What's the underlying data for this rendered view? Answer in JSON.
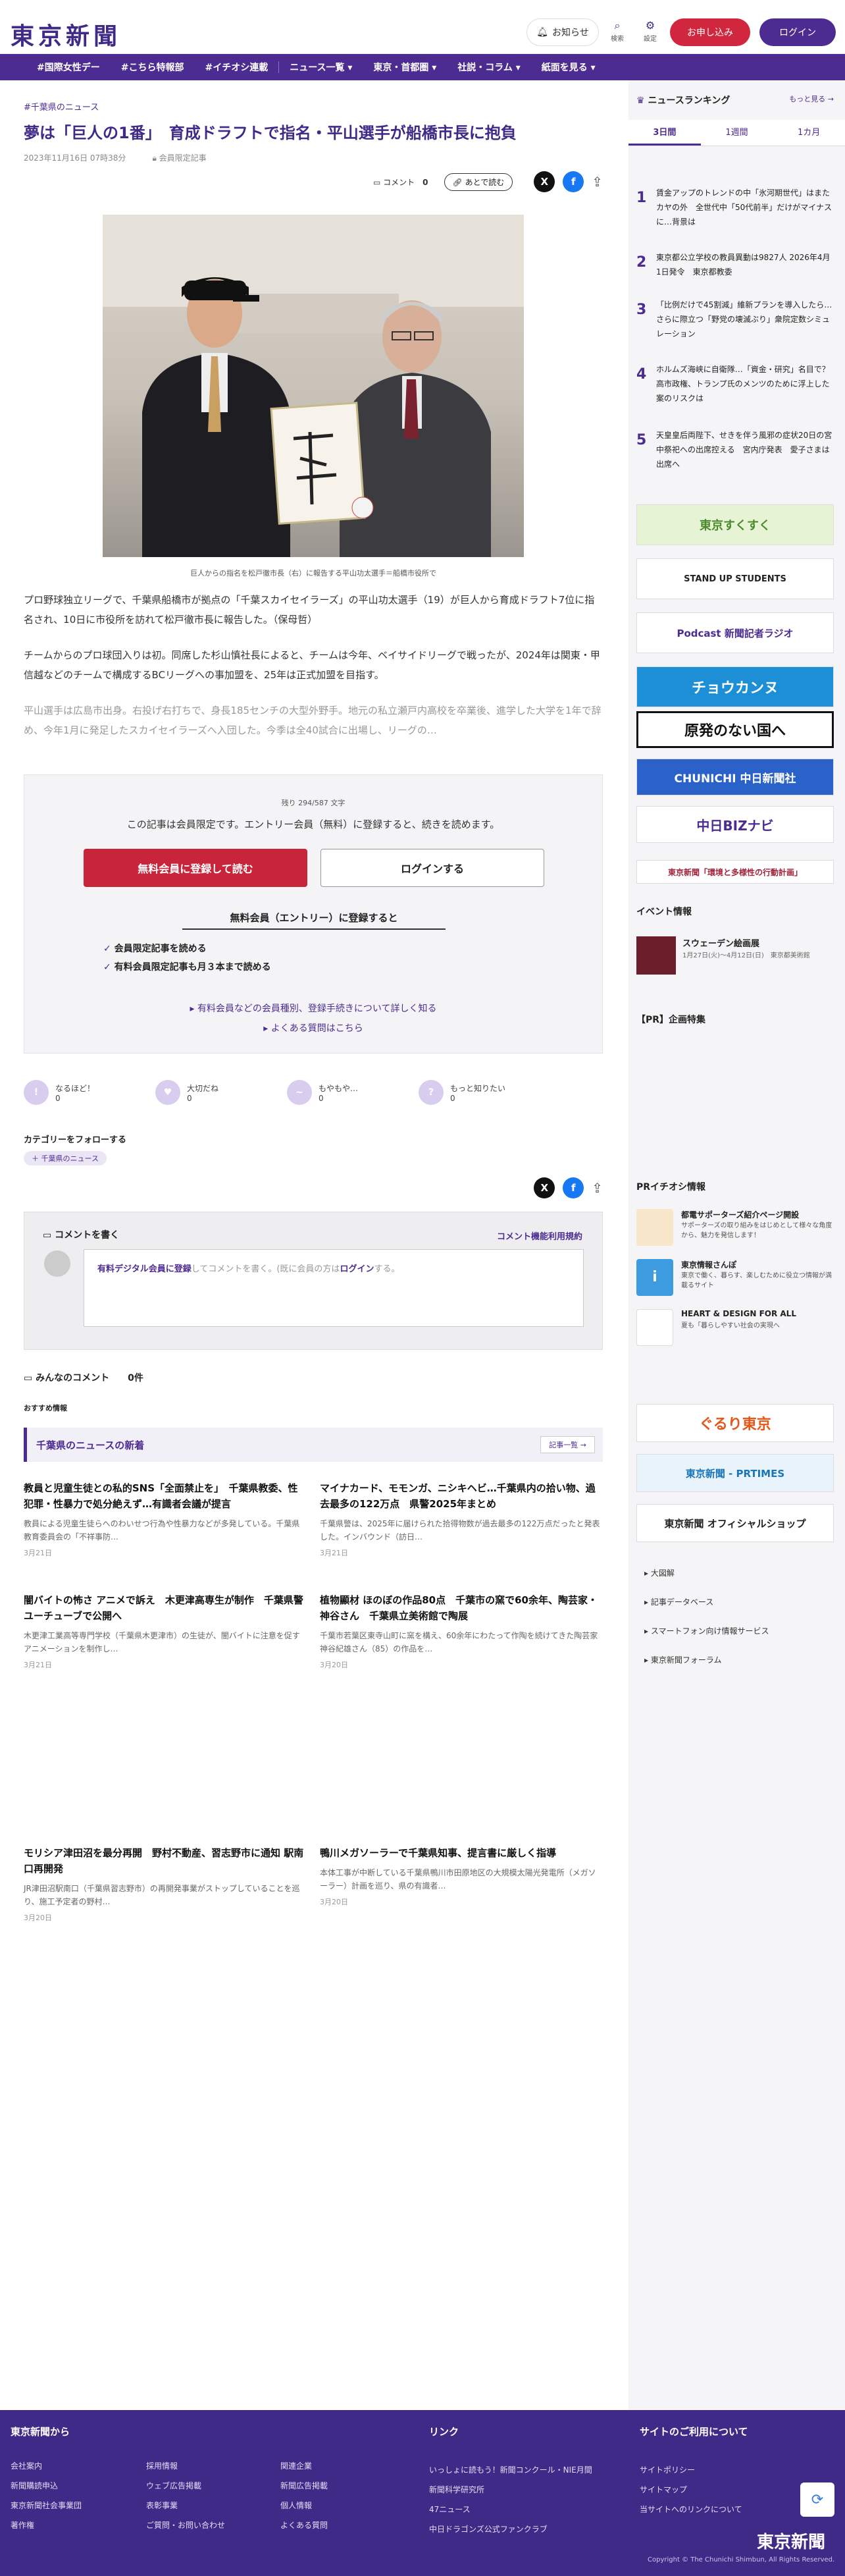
{
  "header": {
    "logo": "東京新聞",
    "notice_label": "お知らせ",
    "search_label": "検索",
    "settings_label": "設定",
    "apply_label": "お申し込み",
    "login_label": "ログイン"
  },
  "nav": {
    "items": [
      "#国際女性デー",
      "#こちら特報部",
      "#イチオシ連載",
      "ニュース一覧 ▾",
      "東京・首都圏 ▾",
      "社説・コラム ▾",
      "紙面を見る ▾"
    ]
  },
  "article": {
    "breadcrumb": "#千葉県のニュース",
    "title": "夢は「巨人の1番」　育成ドラフトで指名・平山選手が船橋市長に抱負",
    "date": "2023年11月16日 07時38分",
    "member_label": "会員限定記事",
    "comment_label": "コメント",
    "comment_count": "0",
    "later_label": "あとで読む",
    "caption": "巨人からの指名を松戸徹市長（右）に報告する平山功太選手＝船橋市役所で",
    "paragraphs": [
      "プロ野球独立リーグで、千葉県船橋市が拠点の「千葉スカイセイラーズ」の平山功太選手（19）が巨人から育成ドラフト7位に指名され、10日に市役所を訪れて松戸徹市長に報告した。（保母哲）",
      "チームからのプロ球団入りは初。同席した杉山慎社長によると、チームは今年、ベイサイドリーグで戦ったが、2024年は関東・甲信越などのチームで構成するBCリーグへの事加盟を、25年は正式加盟を目指す。",
      "平山選手は広島市出身。右投げ右打ちで、身長185センチの大型外野手。地元の私立瀬戸内高校を卒業後、進学した大学を1年で辞め、今年1月に発足したスカイセイラーズへ入団した。今季は全40試合に出場し、リーグの…"
    ]
  },
  "paywall": {
    "remaining": "残り 294/587 文字",
    "message": "この記事は会員限定です。エントリー会員（無料）に登録すると、続きを読めます。",
    "register_label": "無料会員に登録して読む",
    "login_label": "ログインする",
    "benefits_title": "無料会員（エントリー）に登録すると",
    "benefits": [
      "会員限定記事を読める",
      "有料会員限定記事も月３本まで読める"
    ],
    "links": [
      "有料会員などの会員種別、登録手続きについて詳しく知る",
      "よくある質問はこちら"
    ]
  },
  "reactions": [
    {
      "label": "なるほど！",
      "count": "0",
      "icon": "!"
    },
    {
      "label": "大切だね",
      "count": "0",
      "icon": "♥"
    },
    {
      "label": "もやもや…",
      "count": "0",
      "icon": "~"
    },
    {
      "label": "もっと知りたい",
      "count": "0",
      "icon": "?"
    }
  ],
  "follow": {
    "title": "カテゴリーをフォローする",
    "tag": "＋ 千葉県のニュース"
  },
  "comment": {
    "write_label": "コメントを書く",
    "rules_label": "コメント機能利用規約",
    "prompt_link": "有料デジタル会員に登録",
    "prompt_text": "してコメントを書く。(既に会員の方は",
    "prompt_login": "ログイン",
    "prompt_end": "する。",
    "all_label": "みんなのコメント",
    "all_count": "0件"
  },
  "recommend": {
    "label": "おすすめ情報",
    "section_title": "千葉県のニュースの新着",
    "list_label": "記事一覧",
    "cards": [
      {
        "title": "教員と児童生徒との私的SNS「全面禁止を」　千葉県教委、性犯罪・性暴力で処分絶えず…有識者会議が提言",
        "body": "教員による児童生徒らへのわいせつ行為や性暴力などが多発している。千葉県教育委員会の「不祥事防…",
        "date": "3月21日"
      },
      {
        "title": "マイナカード、モモンガ、ニシキヘビ…千葉県内の拾い物、過去最多の122万点　県警2025年まとめ",
        "body": "千葉県警は、2025年に届けられた拾得物数が過去最多の122万点だったと発表した。インバウンド（訪日…",
        "date": "3月21日"
      },
      {
        "title": "闇バイトの怖さ アニメで訴え　木更津高専生が制作　千葉県警ユーチューブで公開へ",
        "body": "木更津工業高等専門学校（千葉県木更津市）の生徒が、闇バイトに注意を促すアニメーションを制作し…",
        "date": "3月21日"
      },
      {
        "title": "植物顯材 ほのぼの作品80点　千葉市の窯で60余年、陶芸家・神谷さん　千葉県立美術館で陶展",
        "body": "千葉市若葉区東寺山町に窯を構え、60余年にわたって作陶を続けてきた陶芸家神谷紀雄さん（85）の作品を…",
        "date": "3月20日"
      },
      {
        "title": "モリシア津田沼を最分再開　野村不動産、習志野市に通知 駅南口再開発",
        "body": "JR津田沼駅南口（千葉県習志野市）の再開発事業がストップしていることを巡り、施工予定者の野村…",
        "date": "3月20日"
      },
      {
        "title": "鴨川メガソーラーで千葉県知事、提言書に厳しく指導",
        "body": "本体工事が中断している千葉県鴨川市田原地区の大規模太陽光発電所（メガソーラー）計画を巡り、県の有識者…",
        "date": "3月20日"
      }
    ]
  },
  "sidebar": {
    "ranking_title": "ニュースランキング",
    "more_label": "もっと見る",
    "tabs": [
      "3日間",
      "1週間",
      "1カ月"
    ],
    "ranking": [
      {
        "num": "1",
        "text": "賃金アップのトレンドの中「氷河期世代」はまたカヤの外　全世代中「50代前半」だけがマイナスに…背景は"
      },
      {
        "num": "2",
        "text": "東京都公立学校の教員異動は9827人 2026年4月1日発令　東京都教委"
      },
      {
        "num": "3",
        "text": "「比例だけで45割減」維新プランを導入したら…さらに際立つ「野党の壊滅ぶり」衆院定数シミュレーション"
      },
      {
        "num": "4",
        "text": "ホルムズ海峡に自衛隊…「資金・研究」名目で？　高市政権、トランプ氏のメンツのために浮上した案のリスクは"
      },
      {
        "num": "5",
        "text": "天皇皇后両陛下、せきを伴う風邪の症状20日の宮中祭祀への出席控える　宮内庁発表　愛子さまは出席へ"
      }
    ],
    "banners": [
      "東京すくすく",
      "STAND UP STUDENTS",
      "Podcast 新聞記者ラジオ",
      "チョウカンヌ",
      "原発のない国へ",
      "CHUNICHI 中日新聞社",
      "中日BIZナビ",
      "東京新聞「環境と多様性の行動計画」"
    ],
    "event_title": "イベント情報",
    "event_name": "スウェーデン絵画展",
    "event_detail": "1月27日(火)〜4月12日(日)　東京都美術館",
    "pr_title": "【PR】企画特集",
    "pr_info_title": "PRイチオシ情報",
    "pr_items": [
      {
        "title": "都電サポーターズ紹介ページ開設",
        "body": "サポーターズの取り組みをはじめとして様々な角度から、魅力を発信します！"
      },
      {
        "title": "東京情報さんぽ",
        "body": "東京で働く、暮らす、楽しむために役立つ情報が満載るサイト"
      },
      {
        "title": "HEART & DESIGN FOR ALL",
        "body": "夏も「暮らしやすい社会の実現へ"
      }
    ],
    "bottom_banners": [
      "ぐるり東京",
      "東京新聞 - PRTIMES",
      "東京新聞 オフィシャルショップ"
    ],
    "links": [
      "大図解",
      "記事データベース",
      "スマートフォン向け情報サービス",
      "東京新聞フォーラム"
    ]
  },
  "footer": {
    "col1_title": "東京新聞から",
    "col1_links": [
      "会社案内",
      "新聞購読申込",
      "東京新聞社会事業団",
      "著作権"
    ],
    "col2_links": [
      "採用情報",
      "ウェブ広告掲載",
      "表彰事業",
      "ご質問・お問い合わせ"
    ],
    "col3_links": [
      "関連企業",
      "新聞広告掲載",
      "個人情報",
      "よくある質問"
    ],
    "col4_title": "リンク",
    "col4_links": [
      "いっしょに読もう！新聞コンクール・NIE月間",
      "新聞科学研究所",
      "47ニュース",
      "中日ドラゴンズ公式ファンクラブ"
    ],
    "col5_title": "サイトのご利用について",
    "col5_links": [
      "サイトポリシー",
      "サイトマップ",
      "当サイトへのリンクについて"
    ],
    "logo": "東京新聞",
    "copyright": "Copyright © The Chunichi Shimbun, All Rights Reserved."
  },
  "colors": {
    "brand": "#4d2c91",
    "accent": "#d0263e"
  }
}
